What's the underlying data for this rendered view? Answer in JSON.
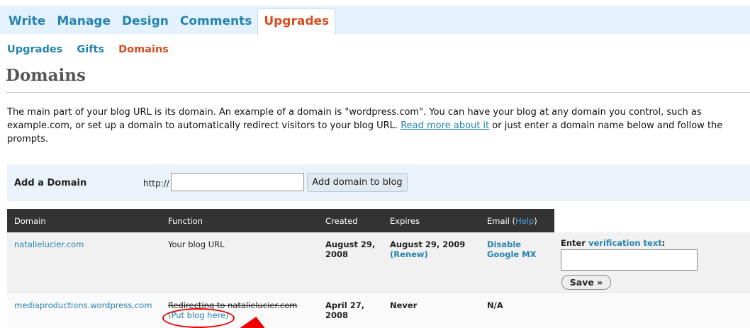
{
  "nav": {
    "tabs": [
      {
        "label": "Write"
      },
      {
        "label": "Manage"
      },
      {
        "label": "Design"
      },
      {
        "label": "Comments"
      },
      {
        "label": "Upgrades",
        "active": true
      }
    ]
  },
  "subnav": {
    "items": [
      {
        "label": "Upgrades"
      },
      {
        "label": "Gifts"
      },
      {
        "label": "Domains",
        "current": true
      }
    ]
  },
  "page": {
    "title": "Domains",
    "intro_before": "The main part of your blog URL is its domain. An example of a domain is \"wordpress.com\". You can have your blog at any domain you control, such as example.com, or set up a domain to automatically redirect visitors to your blog URL. ",
    "intro_link": "Read more about it",
    "intro_after": " or just enter a domain name below and follow the prompts."
  },
  "add_domain": {
    "label": "Add a Domain",
    "prefix": "http://",
    "input_value": "",
    "button_label": "Add domain to blog"
  },
  "table": {
    "headers": {
      "domain": "Domain",
      "function": "Function",
      "created": "Created",
      "expires": "Expires",
      "email": "Email (",
      "email_help": "Help",
      "email_close": ")"
    },
    "rows": [
      {
        "domain": "natalielucier.com",
        "function": "Your blog URL",
        "created": "August 29, 2008",
        "expires": "August 29, 2009",
        "renew": "(Renew)",
        "email_action": "Disable Google MX",
        "verify_label_prefix": "Enter ",
        "verify_link": "verification text",
        "verify_label_suffix": ":",
        "verify_value": "",
        "save_label": "Save »"
      },
      {
        "domain": "mediaproductions.wordpress.com",
        "function": "Redirecting to natalielucier.com",
        "function_link": "(Put blog here)",
        "created": "April 27, 2008",
        "expires": "Never",
        "email": "N/A"
      }
    ]
  },
  "colors": {
    "link": "#2583ad",
    "active": "#d54e21",
    "header_bg": "#333333",
    "annotation": "#ee0000"
  }
}
